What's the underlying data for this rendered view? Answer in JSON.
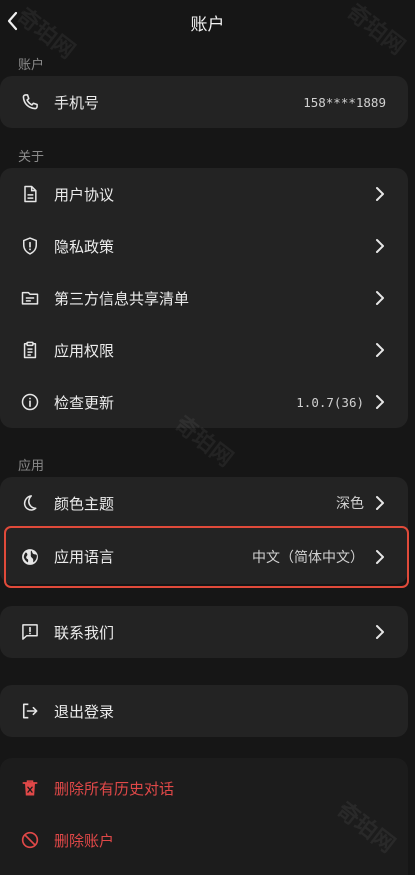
{
  "nav": {
    "title": "账户"
  },
  "sections": {
    "account": "账户",
    "about": "关于",
    "app": "应用"
  },
  "account": {
    "phone_label": "手机号",
    "phone_value": "158****1889"
  },
  "about": {
    "items": [
      {
        "label": "用户协议"
      },
      {
        "label": "隐私政策"
      },
      {
        "label": "第三方信息共享清单"
      },
      {
        "label": "应用权限"
      },
      {
        "label": "检查更新",
        "value": "1.0.7(36)"
      }
    ]
  },
  "app": {
    "theme_label": "颜色主题",
    "theme_value": "深色",
    "language_label": "应用语言",
    "language_value": "中文（简体中文）"
  },
  "contact": {
    "label": "联系我们"
  },
  "logout": {
    "label": "退出登录"
  },
  "danger": {
    "delete_history": "删除所有历史对话",
    "delete_account": "删除账户"
  },
  "watermark": "奇珀网",
  "colors": {
    "background": "#161616",
    "card": "#232323",
    "danger": "#e04848",
    "highlight": "#e04a3a"
  }
}
